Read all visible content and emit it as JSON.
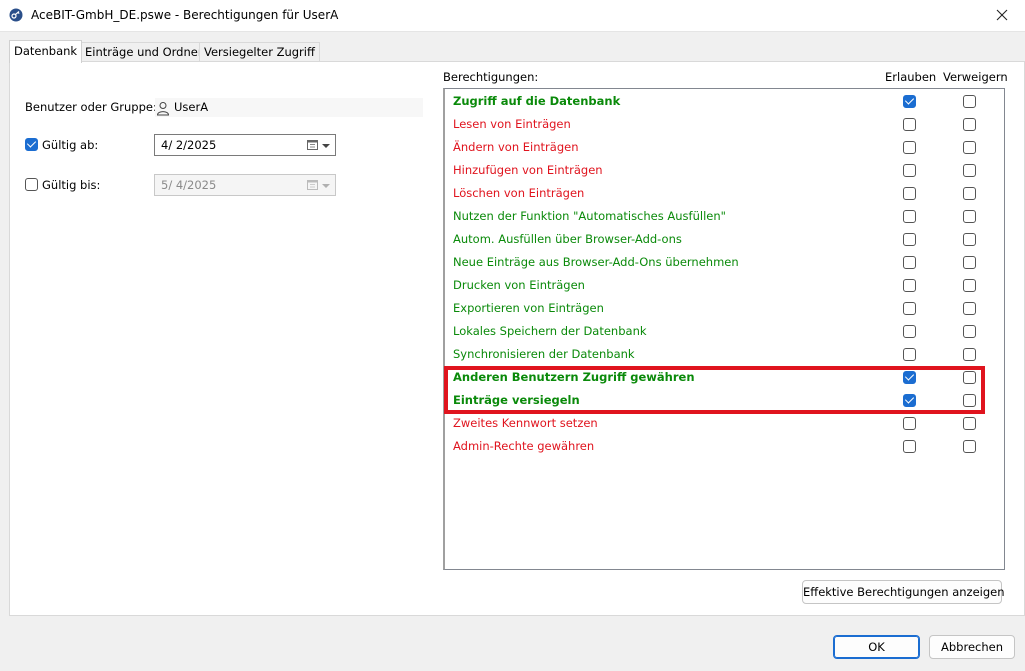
{
  "window": {
    "title": "AceBIT-GmbH_DE.pswe - Berechtigungen für UserA",
    "accent_color": "#1b6dd1",
    "icon": "key-icon"
  },
  "tabs": [
    {
      "label": "Datenbank",
      "active": true
    },
    {
      "label": "Einträge und Ordner",
      "active": false
    },
    {
      "label": "Versiegelter Zugriff",
      "active": false
    }
  ],
  "left": {
    "user_label": "Benutzer oder Gruppe:",
    "user_name": "UserA",
    "valid_from": {
      "label": "Gültig ab:",
      "checked": true,
      "date": "4/  2/2025",
      "enabled": true
    },
    "valid_to": {
      "label": "Gültig bis:",
      "checked": false,
      "date": "5/  4/2025",
      "enabled": false
    }
  },
  "permissions": {
    "header": "Berechtigungen:",
    "col_allow": "Erlauben",
    "col_deny": "Verweigern",
    "colors": {
      "green": "#0a8a0a",
      "red": "#e0141e"
    },
    "items": [
      {
        "label": "Zugriff auf die Datenbank",
        "color": "green",
        "bold": true,
        "allow": true,
        "deny": false
      },
      {
        "label": "Lesen von Einträgen",
        "color": "red",
        "bold": false,
        "allow": false,
        "deny": false
      },
      {
        "label": "Ändern von Einträgen",
        "color": "red",
        "bold": false,
        "allow": false,
        "deny": false
      },
      {
        "label": "Hinzufügen von Einträgen",
        "color": "red",
        "bold": false,
        "allow": false,
        "deny": false
      },
      {
        "label": "Löschen von Einträgen",
        "color": "red",
        "bold": false,
        "allow": false,
        "deny": false
      },
      {
        "label": "Nutzen der Funktion \"Automatisches Ausfüllen\"",
        "color": "green",
        "bold": false,
        "allow": false,
        "deny": false
      },
      {
        "label": "Autom. Ausfüllen über Browser-Add-ons",
        "color": "green",
        "bold": false,
        "allow": false,
        "deny": false
      },
      {
        "label": "Neue Einträge aus Browser-Add-Ons übernehmen",
        "color": "green",
        "bold": false,
        "allow": false,
        "deny": false
      },
      {
        "label": "Drucken von Einträgen",
        "color": "green",
        "bold": false,
        "allow": false,
        "deny": false
      },
      {
        "label": "Exportieren von Einträgen",
        "color": "green",
        "bold": false,
        "allow": false,
        "deny": false
      },
      {
        "label": "Lokales Speichern der Datenbank",
        "color": "green",
        "bold": false,
        "allow": false,
        "deny": false
      },
      {
        "label": "Synchronisieren der Datenbank",
        "color": "green",
        "bold": false,
        "allow": false,
        "deny": false
      },
      {
        "label": "Anderen Benutzern Zugriff gewähren",
        "color": "green",
        "bold": true,
        "allow": true,
        "deny": false
      },
      {
        "label": "Einträge versiegeln",
        "color": "green",
        "bold": true,
        "allow": true,
        "deny": false
      },
      {
        "label": "Zweites Kennwort setzen",
        "color": "red",
        "bold": false,
        "allow": false,
        "deny": false
      },
      {
        "label": "Admin-Rechte gewähren",
        "color": "red",
        "bold": false,
        "allow": false,
        "deny": false
      }
    ]
  },
  "buttons": {
    "effective": "Effektive Berechtigungen anzeigen",
    "ok": "OK",
    "cancel": "Abbrechen"
  }
}
